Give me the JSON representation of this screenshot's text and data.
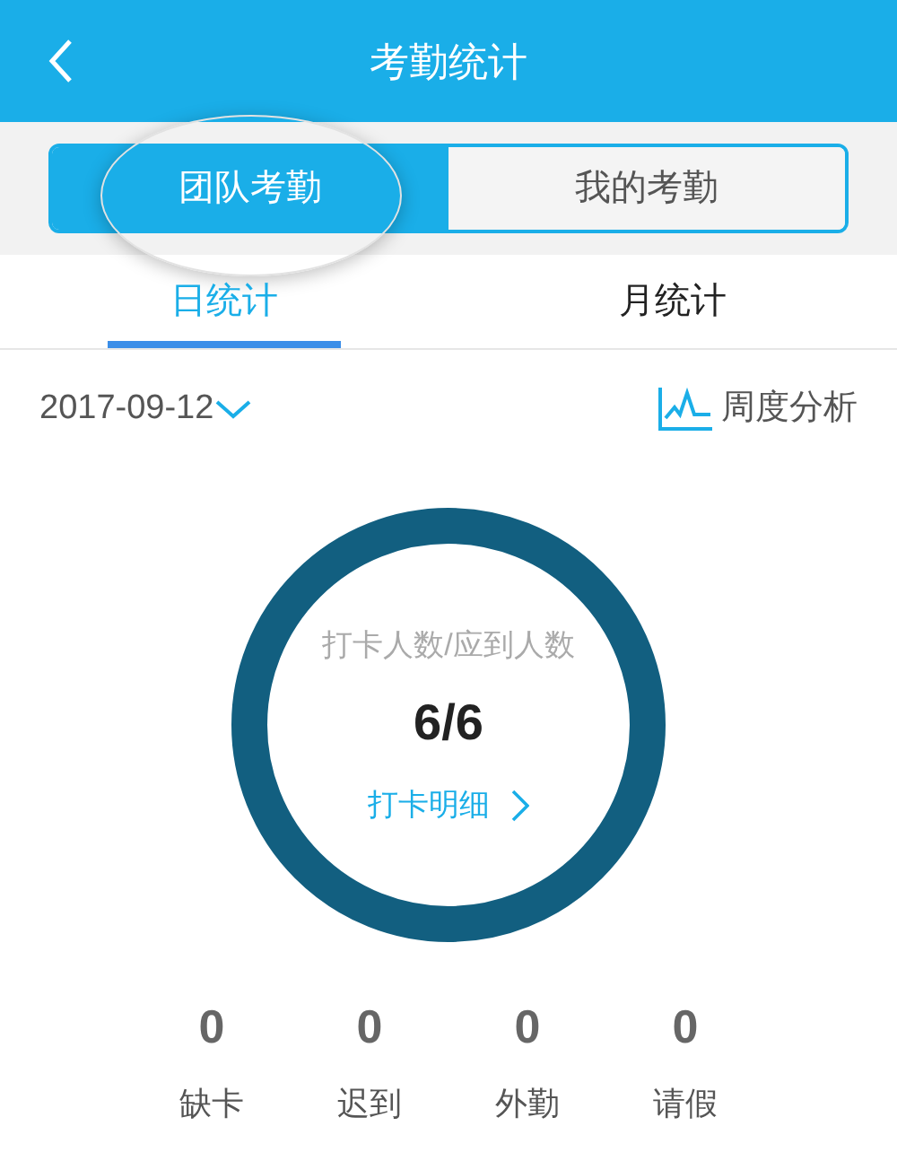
{
  "header": {
    "title": "考勤统计"
  },
  "segments": [
    {
      "label": "团队考勤",
      "selected": true
    },
    {
      "label": "我的考勤",
      "selected": false
    }
  ],
  "tabs": [
    {
      "label": "日统计",
      "selected": true
    },
    {
      "label": "月统计",
      "selected": false
    }
  ],
  "date": "2017-09-12",
  "analysis": "周度分析",
  "summary": {
    "caption": "打卡人数/应到人数",
    "value": "6/6",
    "link": "打卡明细"
  },
  "stats": [
    {
      "value": "0",
      "label": "缺卡"
    },
    {
      "value": "0",
      "label": "迟到"
    },
    {
      "value": "0",
      "label": "外勤"
    },
    {
      "value": "0",
      "label": "请假"
    }
  ]
}
